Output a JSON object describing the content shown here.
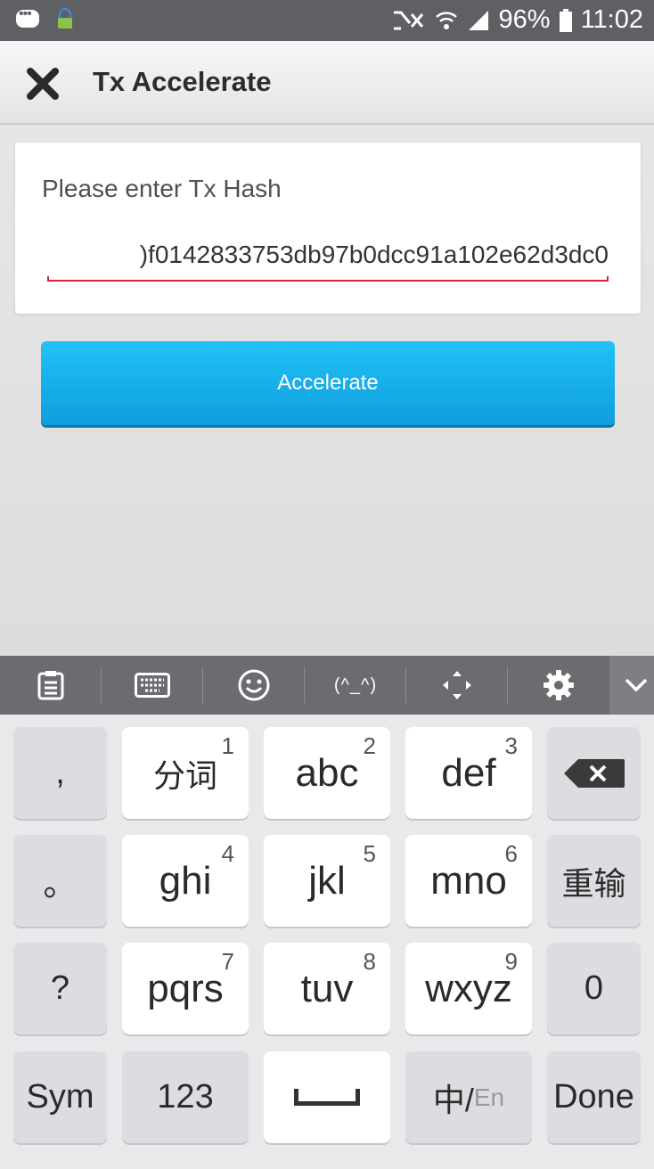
{
  "status_bar": {
    "battery": "96%",
    "time": "11:02"
  },
  "header": {
    "title": "Tx Accelerate"
  },
  "form": {
    "label": "Please enter Tx Hash",
    "hash_value": ")f0142833753db97b0dcc91a102e62d3dc0"
  },
  "accelerate_label": "Accelerate",
  "keyboard": {
    "emoticon_label": "(^_^)",
    "keys": {
      "comma": ",",
      "fenci": "分词",
      "abc": "abc",
      "def": "def",
      "period": "。",
      "ghi": "ghi",
      "jkl": "jkl",
      "mno": "mno",
      "reinput": "重输",
      "question": "?",
      "pqrs": "pqrs",
      "tuv": "tuv",
      "wxyz": "wxyz",
      "zero": "0",
      "sym": "Sym",
      "n123": "123",
      "lang_cn": "中/",
      "lang_en": "En",
      "done": "Done"
    },
    "numbers": [
      "1",
      "2",
      "3",
      "4",
      "5",
      "6",
      "7",
      "8",
      "9"
    ]
  },
  "colors": {
    "accent": "#1aaeea",
    "status_bar": "#5f6063",
    "error_underline": "#dd2233"
  }
}
